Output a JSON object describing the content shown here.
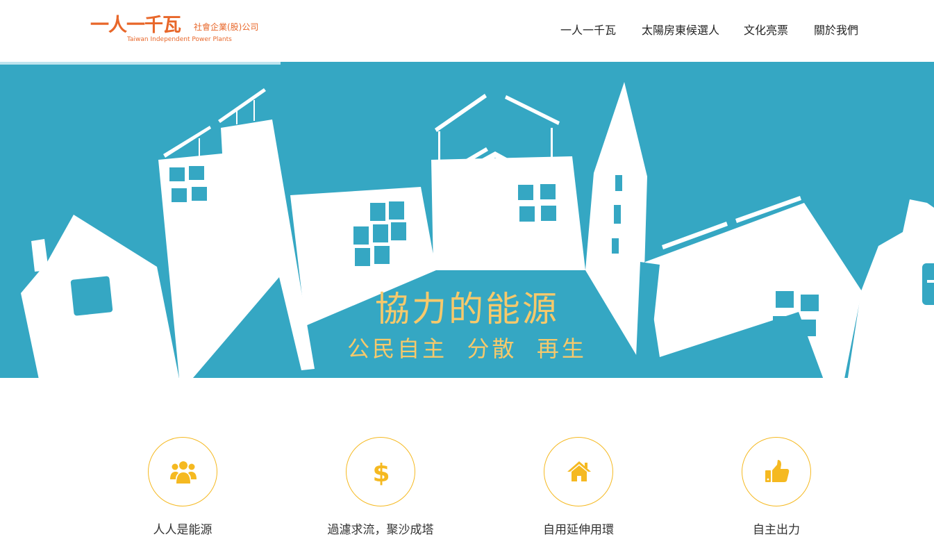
{
  "brand": {
    "name": "一人一千瓦",
    "subtitle": "社會企業(股)公司",
    "english": "Taiwan Independent Power Plants",
    "color": "#e8672a"
  },
  "nav": {
    "items": [
      {
        "label": "一人一千瓦"
      },
      {
        "label": "太陽房東候選人"
      },
      {
        "label": "文化亮票"
      },
      {
        "label": "關於我們"
      }
    ]
  },
  "scroll_progress": 0.3,
  "hero": {
    "title": "協力的能源",
    "subtitle": "公民自主  分散  再生",
    "background": "#35a7c3",
    "text_color": "#f6c96b"
  },
  "features": [
    {
      "icon": "users-icon",
      "label": "人人是能源"
    },
    {
      "icon": "dollar-icon",
      "label": "過濾求流，聚沙成塔"
    },
    {
      "icon": "home-icon",
      "label": "自用延伸用環"
    },
    {
      "icon": "thumbs-up-icon",
      "label": "自主出力"
    }
  ],
  "accent": "#f5b921"
}
